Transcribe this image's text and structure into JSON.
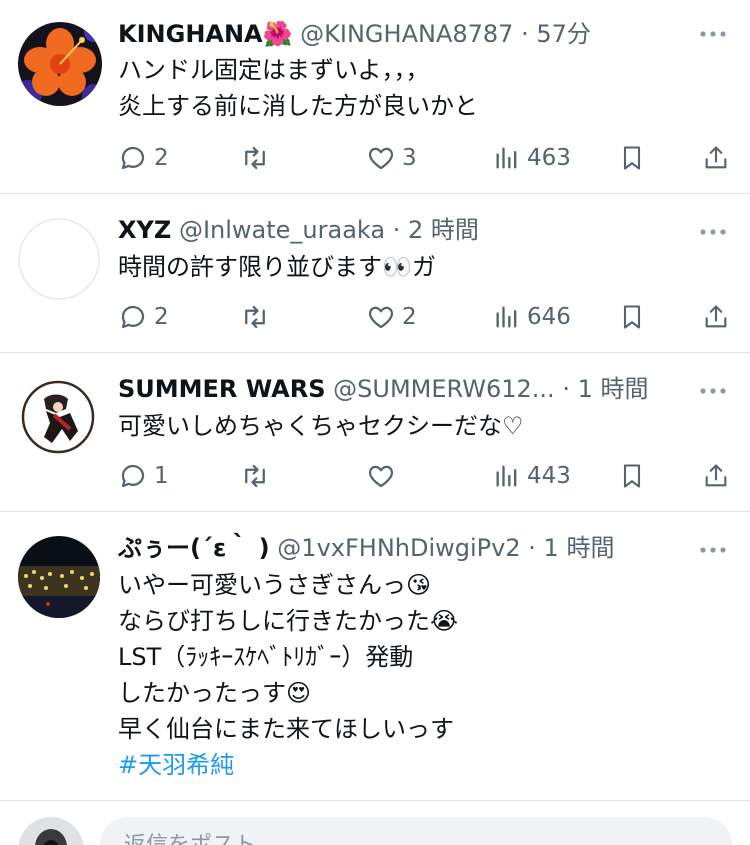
{
  "tweets": [
    {
      "name": "KINGHANA🌺",
      "handle": "@KINGHANA8787",
      "separator": "·",
      "time": "57分",
      "lines": [
        "ハンドル固定はまずいよ，，，",
        "炎上する前に消した方が良いかと"
      ],
      "hashtag": "",
      "replies": "2",
      "retweets": "",
      "likes": "3",
      "views": "463"
    },
    {
      "name": "XYZ",
      "handle": "@Inlwate_uraaka",
      "separator": "·",
      "time": "2 時間",
      "lines": [
        "時間の許す限り並びます👀ガ"
      ],
      "hashtag": "",
      "replies": "2",
      "retweets": "",
      "likes": "2",
      "views": "646"
    },
    {
      "name": "SUMMER WARS",
      "handle": "@SUMMERW612...",
      "separator": "·",
      "time": "1 時間",
      "lines": [
        "可愛いしめちゃくちゃセクシーだな♡"
      ],
      "hashtag": "",
      "replies": "1",
      "retweets": "",
      "likes": "",
      "views": "443"
    },
    {
      "name": "ぷぅー(´ε｀ )",
      "handle": "@1vxFHNhDiwgiPv2",
      "separator": "·",
      "time": "1 時間",
      "lines": [
        "いやー可愛いうさぎさんっ😘",
        "ならび打ちしに行きたかった😭",
        "LST（ﾗｯｷｰｽｹﾍﾞﾄﾘｶﾞｰ）発動",
        "したかったっす😍",
        "早く仙台にまた来てほしいっす"
      ],
      "hashtag": "#天羽希純",
      "replies": "",
      "retweets": "",
      "likes": "",
      "views": ""
    }
  ],
  "reply": {
    "placeholder": "返信をポスト"
  },
  "icons": {
    "more": "more-dots-icon",
    "reply": "reply-bubble-icon",
    "retweet": "retweet-icon",
    "like": "heart-icon",
    "views": "views-bars-icon",
    "bookmark": "bookmark-icon",
    "share": "share-icon"
  },
  "colors": {
    "text": "#0f1419",
    "secondary": "#536471",
    "link": "#1d9bf0",
    "divider": "#e1e4e7",
    "input_bg": "#eff3f4"
  }
}
